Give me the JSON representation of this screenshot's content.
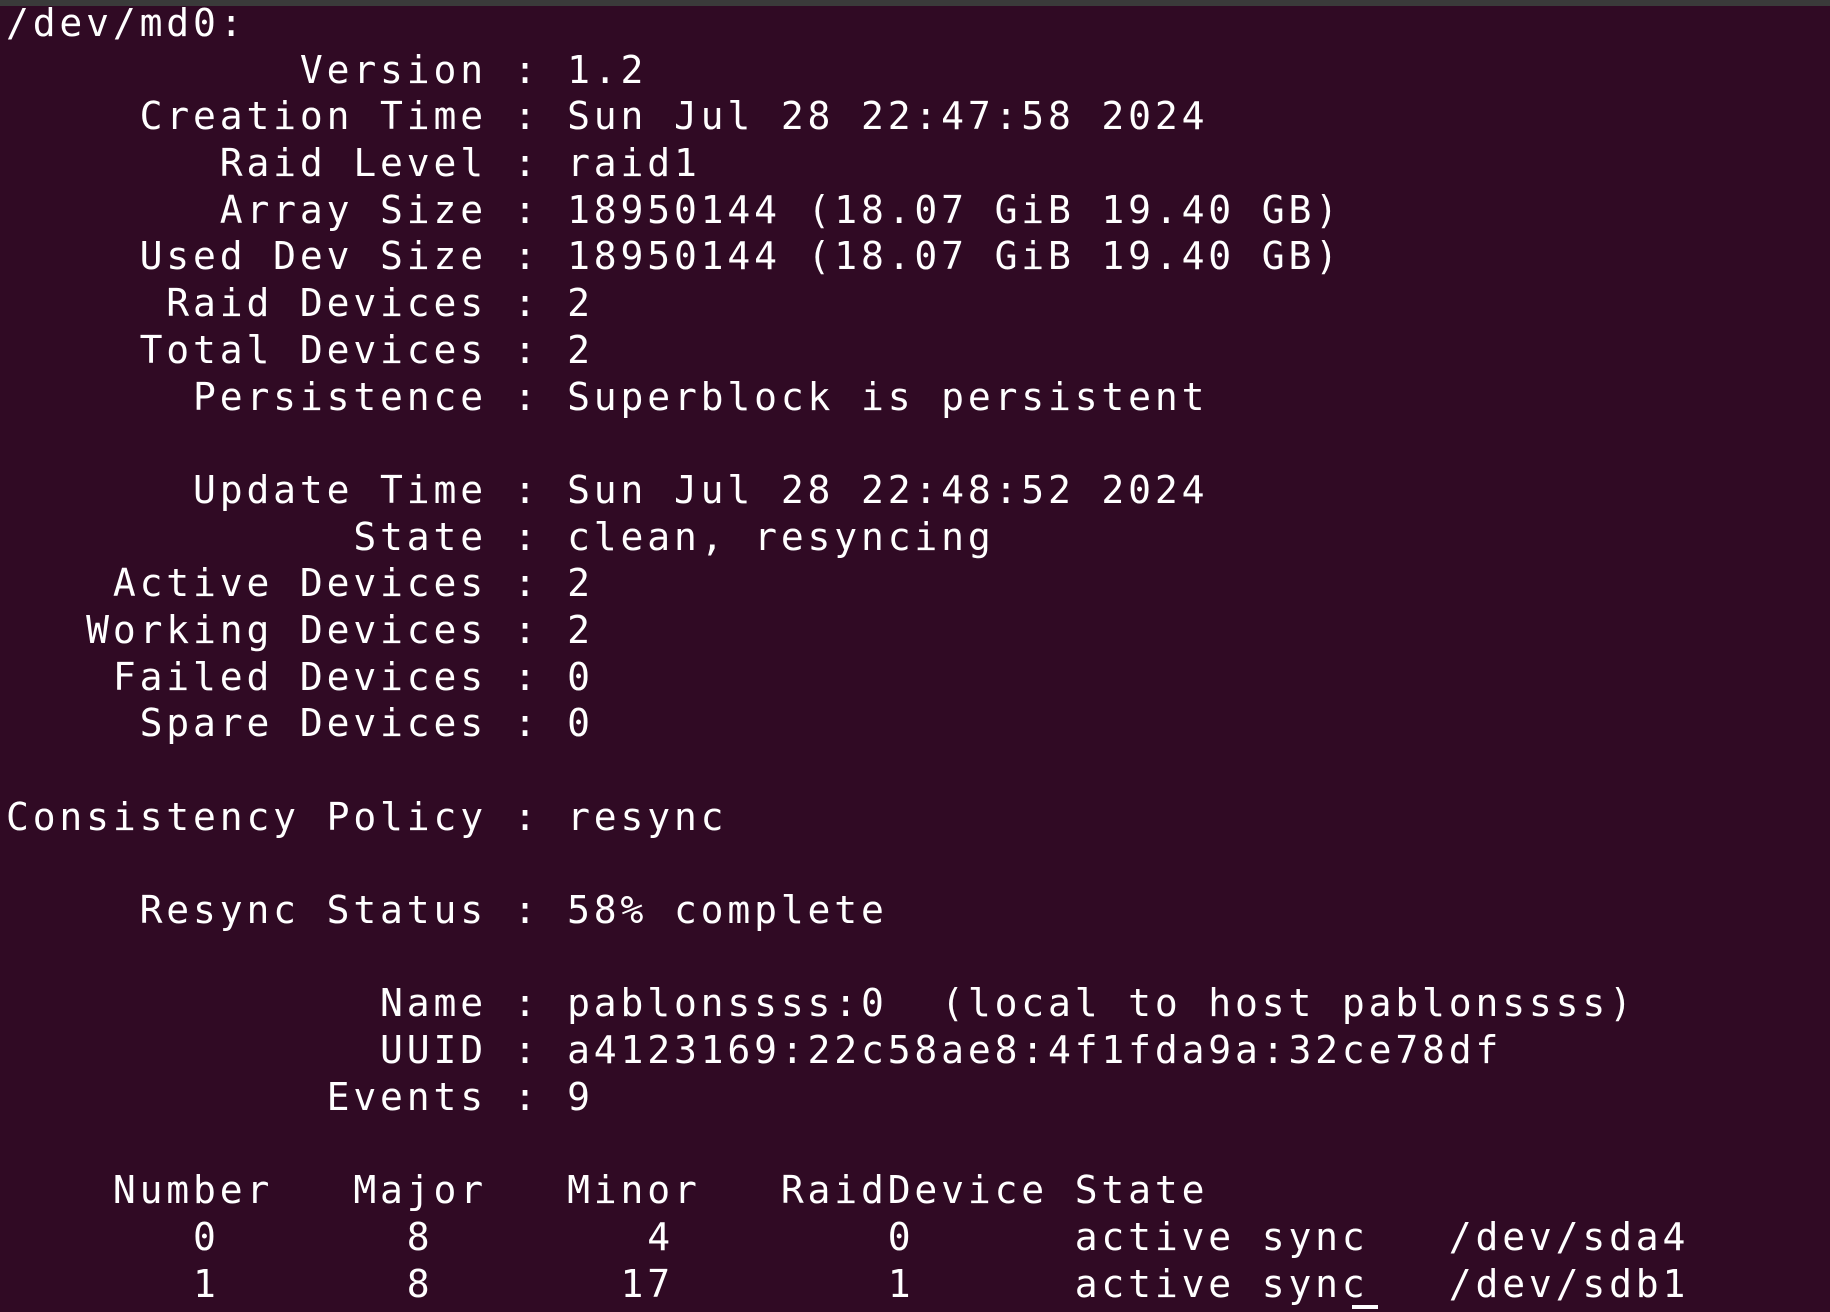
{
  "terminal": {
    "lines": [
      "/dev/md0:",
      "           Version : 1.2",
      "     Creation Time : Sun Jul 28 22:47:58 2024",
      "        Raid Level : raid1",
      "        Array Size : 18950144 (18.07 GiB 19.40 GB)",
      "     Used Dev Size : 18950144 (18.07 GiB 19.40 GB)",
      "      Raid Devices : 2",
      "     Total Devices : 2",
      "       Persistence : Superblock is persistent",
      "",
      "       Update Time : Sun Jul 28 22:48:52 2024",
      "             State : clean, resyncing",
      "    Active Devices : 2",
      "   Working Devices : 2",
      "    Failed Devices : 0",
      "     Spare Devices : 0",
      "",
      "Consistency Policy : resync",
      "",
      "     Resync Status : 58% complete",
      "",
      "              Name : pablonssss:0  (local to host pablonssss)",
      "              UUID : a4123169:22c58ae8:4f1fda9a:32ce78df",
      "            Events : 9",
      "",
      "    Number   Major   Minor   RaidDevice State",
      "       0       8        4        0      active sync   /dev/sda4",
      "       1       8       17        1      active sync   /dev/sdb1"
    ]
  },
  "colors": {
    "background": "#300a24",
    "foreground": "#ffffff"
  }
}
